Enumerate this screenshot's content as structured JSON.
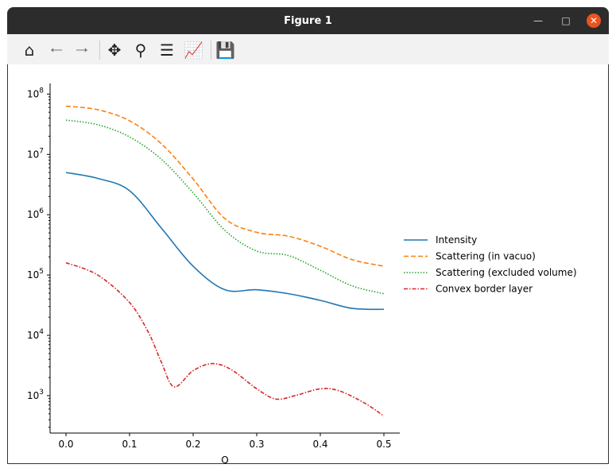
{
  "window": {
    "title": "Figure 1"
  },
  "toolbar": {
    "items": [
      "home-icon",
      "back-icon",
      "forward-icon",
      "pan-icon",
      "zoom-icon",
      "configure-subplots-icon",
      "edit-axes-icon",
      "save-icon"
    ]
  },
  "chart_data": {
    "type": "line",
    "xlabel": "Q",
    "ylabel": "",
    "xlim": [
      -0.025,
      0.525
    ],
    "ylim": [
      240,
      150000000
    ],
    "yscale": "log",
    "xticks": [
      "0.0",
      "0.1",
      "0.2",
      "0.3",
      "0.4",
      "0.5"
    ],
    "yticks": [
      "10^3",
      "10^4",
      "10^5",
      "10^6",
      "10^7",
      "10^8"
    ],
    "legend_position": "right",
    "series": [
      {
        "name": "Intensity",
        "color": "#1f77b4",
        "dash": "solid",
        "x": [
          0,
          0.05,
          0.1,
          0.15,
          0.2,
          0.25,
          0.3,
          0.35,
          0.4,
          0.45,
          0.5
        ],
        "values": [
          5000000.0,
          4000000.0,
          2500000.0,
          600000.0,
          140000.0,
          57000.0,
          57000.0,
          49000.0,
          38000.0,
          28000.0,
          27000.0
        ]
      },
      {
        "name": "Scattering (in vacuo)",
        "color": "#ff7f0e",
        "dash": "dashed",
        "x": [
          0,
          0.05,
          0.1,
          0.15,
          0.2,
          0.25,
          0.3,
          0.35,
          0.4,
          0.45,
          0.5
        ],
        "values": [
          63000000.0,
          55000000.0,
          36000000.0,
          15000000.0,
          3900000.0,
          860000.0,
          510000.0,
          440000.0,
          300000.0,
          180000.0,
          140000.0
        ]
      },
      {
        "name": "Scattering (excluded volume)",
        "color": "#2ca02c",
        "dash": "dotted",
        "x": [
          0,
          0.05,
          0.1,
          0.15,
          0.2,
          0.25,
          0.3,
          0.35,
          0.4,
          0.45,
          0.5
        ],
        "values": [
          37000000.0,
          31000000.0,
          19500000.0,
          8300000.0,
          2300000.0,
          550000.0,
          250000.0,
          210000.0,
          120000.0,
          66000.0,
          49000.0
        ]
      },
      {
        "name": "Convex border layer",
        "color": "#d62728",
        "dash": "dashdot",
        "x": [
          0,
          0.05,
          0.1,
          0.13,
          0.15,
          0.17,
          0.2,
          0.23,
          0.26,
          0.3,
          0.33,
          0.36,
          0.4,
          0.43,
          0.47,
          0.5
        ],
        "values": [
          160000.0,
          100000.0,
          35000.0,
          11000.0,
          3600.0,
          1400.0,
          2600.0,
          3400.0,
          2700.0,
          1300.0,
          880,
          1000,
          1300,
          1200,
          750,
          460
        ]
      }
    ]
  }
}
